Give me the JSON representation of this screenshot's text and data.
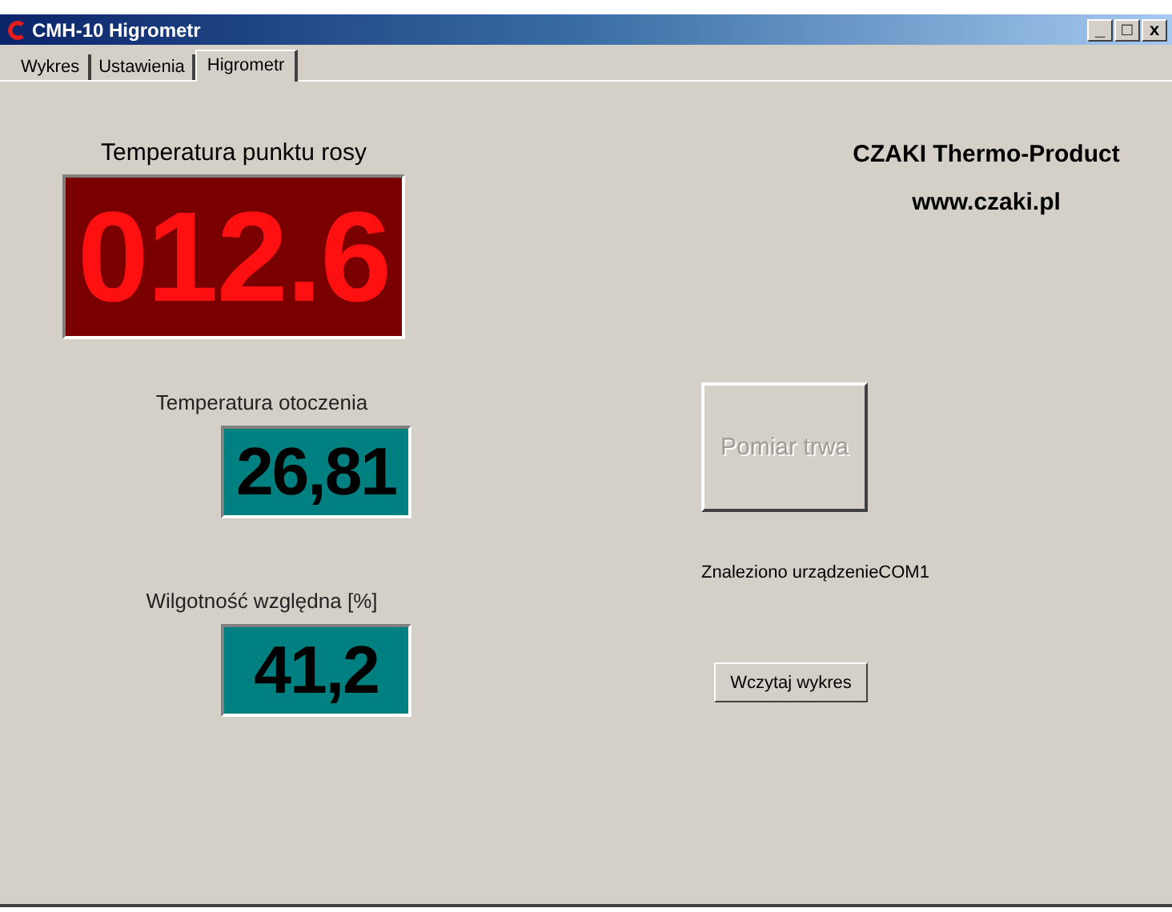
{
  "window": {
    "title": "CMH-10 Higrometr",
    "controls": [
      "_",
      "□",
      "x"
    ]
  },
  "tabs": [
    {
      "label": "Wykres",
      "selected": false
    },
    {
      "label": "Ustawienia",
      "selected": false
    },
    {
      "label": "Higrometr",
      "selected": true
    }
  ],
  "displays": [
    {
      "label": "Temperatura punktu rosy",
      "value": "012.6",
      "kind": "dewpoint"
    },
    {
      "label": "Temperatura otoczenia",
      "value": "26,81",
      "kind": "reading"
    },
    {
      "label": "Wilgotność względna [%]",
      "value": "41,2",
      "kind": "reading"
    }
  ],
  "brand": {
    "name": "CZAKI Thermo-Product",
    "url": "www.czaki.pl"
  },
  "measure_button": {
    "label": "Pomiar trwa",
    "disabled": true
  },
  "status": "Znaleziono urządzenieCOM1",
  "load_button": {
    "label": "Wczytaj wykres",
    "disabled": false
  }
}
